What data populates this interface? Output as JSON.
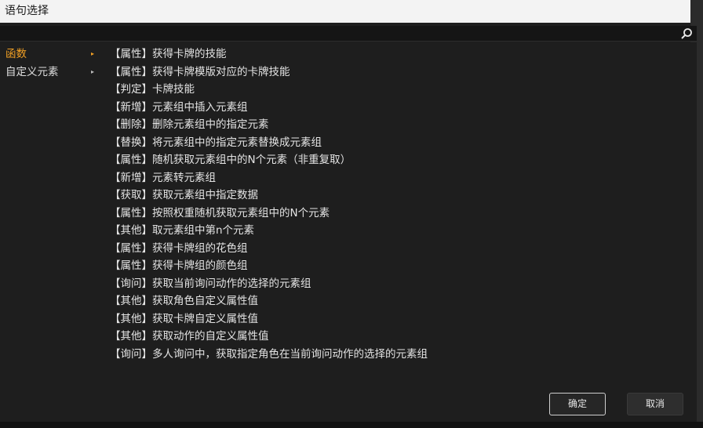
{
  "window": {
    "title": "语句选择"
  },
  "search": {
    "value": "",
    "placeholder": ""
  },
  "categories": [
    {
      "label": "函数",
      "arrow": "▸",
      "active": true
    },
    {
      "label": "自定义元素",
      "arrow": "▸",
      "active": false
    }
  ],
  "statements": [
    "【属性】获得卡牌的技能",
    "【属性】获得卡牌模版对应的卡牌技能",
    "【判定】卡牌技能",
    "【新增】元素组中插入元素组",
    "【删除】删除元素组中的指定元素",
    "【替换】将元素组中的指定元素替换成元素组",
    "【属性】随机获取元素组中的N个元素（非重复取）",
    "【新增】元素转元素组",
    "【获取】获取元素组中指定数据",
    "【属性】按照权重随机获取元素组中的N个元素",
    "【其他】取元素组中第n个元素",
    "【属性】获得卡牌组的花色组",
    "【属性】获得卡牌组的颜色组",
    "【询问】获取当前询问动作的选择的元素组",
    "【其他】获取角色自定义属性值",
    "【其他】获取卡牌自定义属性值",
    "【其他】获取动作的自定义属性值",
    "【询问】多人询问中，获取指定角色在当前询问动作的选择的元素组"
  ],
  "buttons": {
    "ok": "确定",
    "cancel": "取消"
  },
  "colors": {
    "accent": "#f2a024",
    "background": "#1e1e1e",
    "titlebar": "#f3f3f3"
  },
  "icons": {
    "search": "search-icon"
  }
}
